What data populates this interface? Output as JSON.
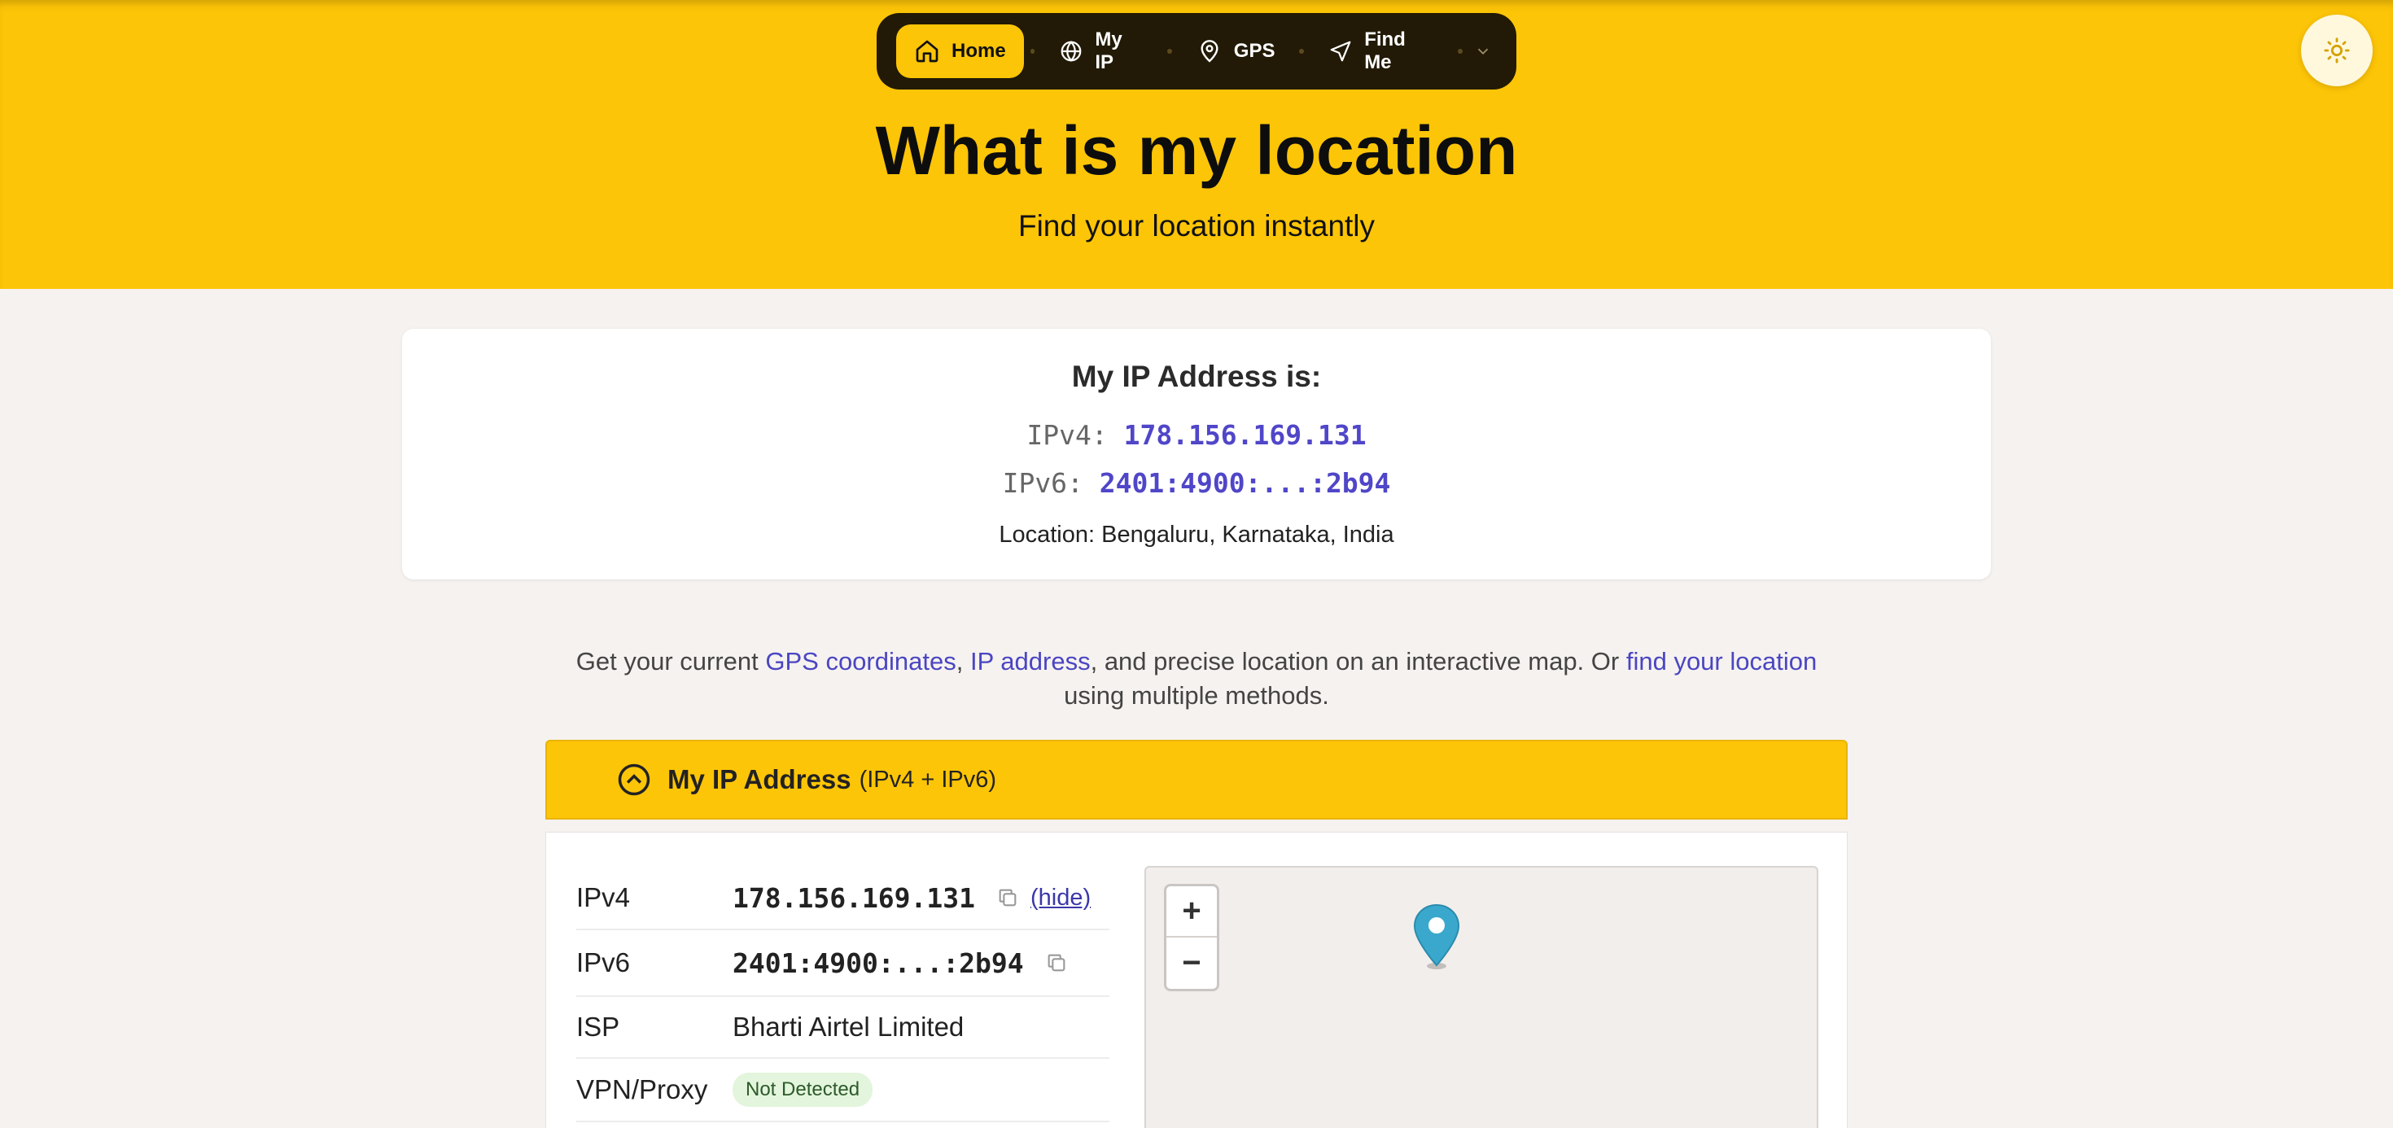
{
  "nav": {
    "items": [
      {
        "label": "Home",
        "icon": "home-icon",
        "active": true
      },
      {
        "label": "My IP",
        "icon": "globe-icon"
      },
      {
        "label": "GPS",
        "icon": "map-pin-icon"
      },
      {
        "label": "Find Me",
        "icon": "navigation-icon"
      }
    ],
    "more_icon": "chevron-down-icon"
  },
  "theme_toggle_icon": "sun-icon",
  "hero": {
    "title": "What is my location",
    "subtitle": "Find your location instantly"
  },
  "ip_card": {
    "title": "My IP Address is:",
    "ipv4_label": "IPv4:",
    "ipv4_value": "178.156.169.131",
    "ipv6_label": "IPv6:",
    "ipv6_value": "2401:4900:...:2b94",
    "location": "Location: Bengaluru, Karnataka, India"
  },
  "intro": {
    "prefix": "Get your current ",
    "link_gps": "GPS coordinates",
    "sep1": ", ",
    "link_ip": "IP address",
    "middle": ", and precise location on an interactive map. Or ",
    "link_find": "find your location",
    "suffix": " using multiple methods."
  },
  "accordion": {
    "title": "My IP Address",
    "subtitle": "(IPv4 + IPv6)",
    "rows": {
      "ipv4": {
        "label": "IPv4",
        "value": "178.156.169.131",
        "hide": "(hide)"
      },
      "ipv6": {
        "label": "IPv6",
        "value": "2401:4900:...:2b94"
      },
      "isp": {
        "label": "ISP",
        "value": "Bharti Airtel Limited"
      },
      "vpn": {
        "label": "VPN/Proxy",
        "value": "Not Detected"
      }
    }
  },
  "map": {
    "zoom_in": "+",
    "zoom_out": "−"
  },
  "colors": {
    "brand_yellow": "#fdc507",
    "nav_dark": "#221a06",
    "link": "#4a46c2",
    "ip_value": "#5046c8",
    "marker": "#3aa8cc"
  }
}
